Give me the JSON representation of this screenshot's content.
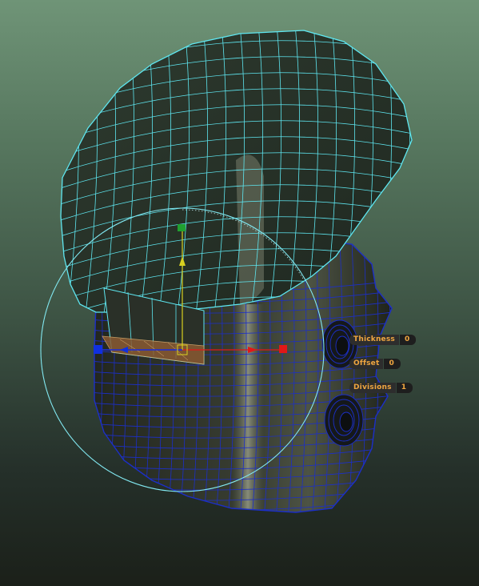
{
  "hud": {
    "thickness": {
      "label": "Thickness",
      "value": "0"
    },
    "offset": {
      "label": "Offset",
      "value": "0"
    },
    "divisions": {
      "label": "Divisions",
      "value": "1"
    }
  },
  "colors": {
    "wire_selected": "#5ee6f0",
    "wire_deselected": "#1c2fc8",
    "hud_text": "#f0a640",
    "axis_x": "#e01818",
    "axis_y": "#d8d020",
    "axis_z": "#1030e0",
    "rotate_ring": "#7fe7f0"
  },
  "icons": [
    "move-manipulator-icon",
    "rotate-ring-icon"
  ]
}
